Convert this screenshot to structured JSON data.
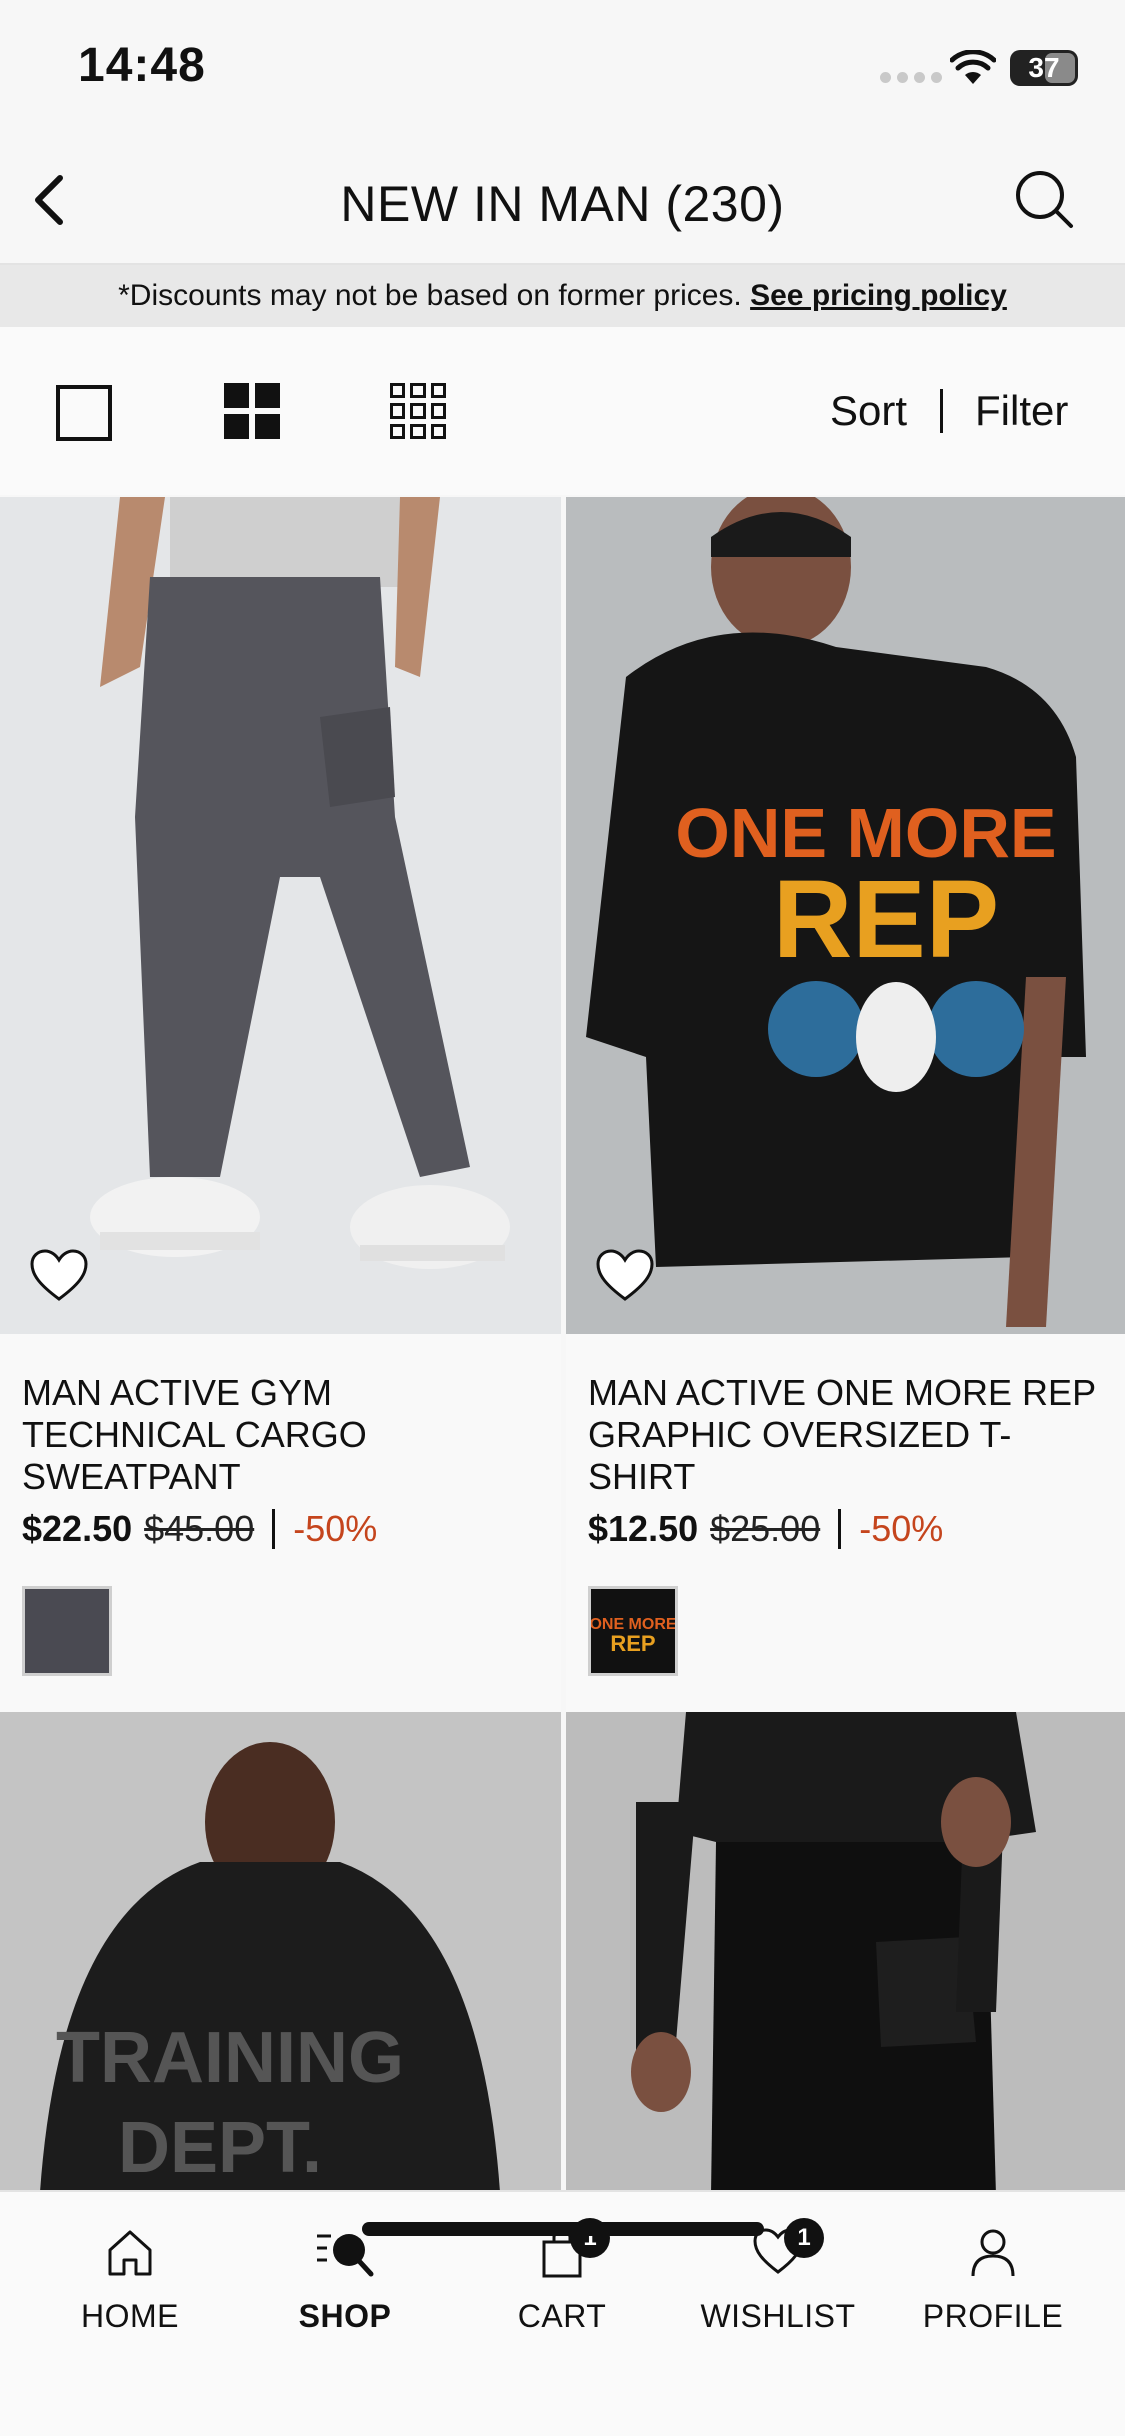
{
  "status_bar": {
    "time": "14:48",
    "battery": "37"
  },
  "header": {
    "title": "NEW IN MAN (230)"
  },
  "disclaimer": {
    "text": "*Discounts may not be based on former prices.",
    "link": "See pricing policy"
  },
  "toolbar": {
    "sort_label": "Sort",
    "filter_label": "Filter"
  },
  "products": [
    {
      "name": "MAN ACTIVE GYM TECHNICAL CARGO SWEATPANT",
      "price": "$22.50",
      "old_price": "$45.00",
      "discount": "-50%",
      "swatch_color": "#4a4a52"
    },
    {
      "name": "MAN ACTIVE ONE MORE REP GRAPHIC OVERSIZED T-SHIRT",
      "price": "$12.50",
      "old_price": "$25.00",
      "discount": "-50%",
      "swatch_color": "#111111"
    },
    {
      "image_text": "TRAINING DEPT."
    },
    {}
  ],
  "bottom_nav": {
    "home": "HOME",
    "shop": "SHOP",
    "cart": "CART",
    "cart_badge": "1",
    "wishlist": "WISHLIST",
    "wishlist_badge": "1",
    "profile": "PROFILE"
  },
  "colors": {
    "discount": "#c5451d",
    "background": "#f7f7f7",
    "disclaimer_bg": "#e8e8e8"
  }
}
